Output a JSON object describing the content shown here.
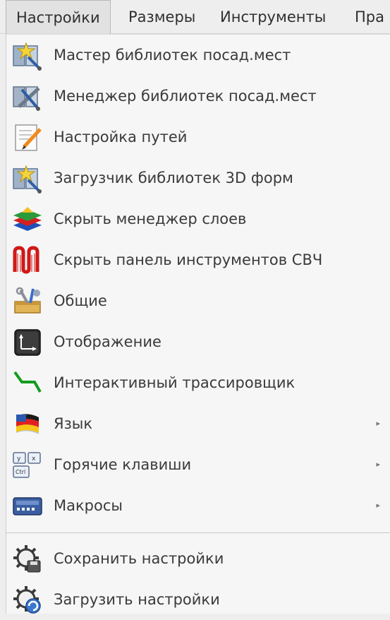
{
  "menubar": {
    "items": [
      {
        "label": "Настройки",
        "active": true
      },
      {
        "label": "Размеры"
      },
      {
        "label": "Инструменты"
      },
      {
        "label": "Пра"
      }
    ]
  },
  "menu": {
    "items": [
      {
        "label": "Мастер библиотек посад.мест",
        "icon": "library-wizard-icon"
      },
      {
        "label": "Менеджер библиотек посад.мест",
        "icon": "library-manager-icon"
      },
      {
        "label": "Настройка путей",
        "icon": "paths-config-icon"
      },
      {
        "label": "Загрузчик библиотек 3D форм",
        "icon": "3d-library-loader-icon"
      },
      {
        "label": "Скрыть менеджер слоев",
        "icon": "layers-manager-icon"
      },
      {
        "label": "Скрыть панель инструментов СВЧ",
        "icon": "microwave-toolbar-icon"
      },
      {
        "label": "Общие",
        "icon": "general-settings-icon"
      },
      {
        "label": "Отображение",
        "icon": "display-settings-icon"
      },
      {
        "label": "Интерактивный трассировщик",
        "icon": "interactive-router-icon"
      },
      {
        "label": "Язык",
        "icon": "language-flag-icon",
        "submenu": true
      },
      {
        "label": "Горячие клавиши",
        "icon": "hotkeys-icon",
        "submenu": true
      },
      {
        "label": "Макросы",
        "icon": "macros-icon",
        "submenu": true
      },
      {
        "label": "Сохранить настройки",
        "icon": "save-settings-icon"
      },
      {
        "label": "Загрузить настройки",
        "icon": "load-settings-icon"
      }
    ]
  },
  "colors": {
    "background": "#eeeeee",
    "menu_background": "#f6f6f6",
    "text": "#3a3a3a"
  }
}
